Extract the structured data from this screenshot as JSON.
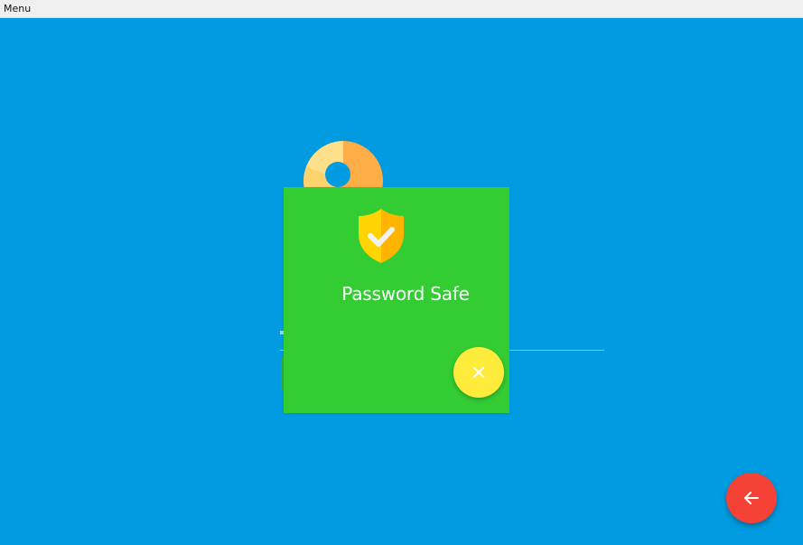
{
  "menubar": {
    "menu_label": "Menu"
  },
  "dialog": {
    "title": "Password Safe",
    "icon": "shield-check-icon",
    "close_icon": "close-icon"
  },
  "back_button": {
    "icon": "arrow-left-icon"
  },
  "colors": {
    "background": "#009be0",
    "dialog": "#33cc33",
    "close_button": "#ffeb3b",
    "back_button": "#f44336",
    "shield_light": "#ffd400",
    "shield_dark": "#ffb400",
    "logo_orange": "#ffad47",
    "logo_yellow": "#ffe08a"
  }
}
